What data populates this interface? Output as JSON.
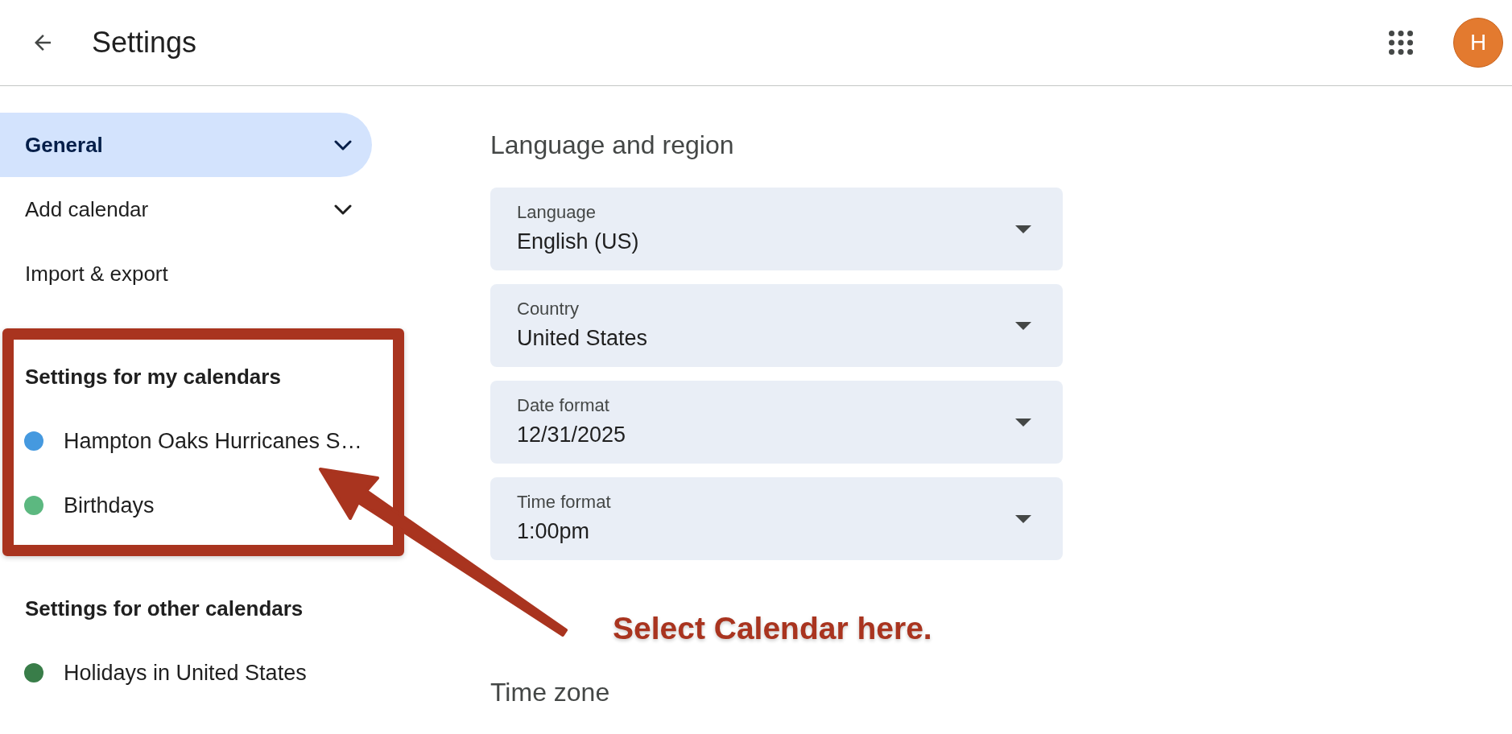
{
  "header": {
    "title": "Settings",
    "avatar_initial": "H"
  },
  "sidebar": {
    "nav_items": [
      {
        "label": "General",
        "kind": "expandable",
        "selected": true
      },
      {
        "label": "Add calendar",
        "kind": "expandable",
        "selected": false
      },
      {
        "label": "Import & export",
        "kind": "link",
        "selected": false
      }
    ],
    "sections": [
      {
        "title": "Settings for my calendars",
        "calendars": [
          {
            "name": "Hampton Oaks Hurricanes S…",
            "color": "#4599df"
          },
          {
            "name": "Birthdays",
            "color": "#5cb880"
          }
        ]
      },
      {
        "title": "Settings for other calendars",
        "calendars": [
          {
            "name": "Holidays in United States",
            "color": "#397d49"
          }
        ]
      }
    ]
  },
  "main": {
    "sections": [
      {
        "title": "Language and region",
        "fields": [
          {
            "label": "Language",
            "value": "English (US)"
          },
          {
            "label": "Country",
            "value": "United States"
          },
          {
            "label": "Date format",
            "value": "12/31/2025"
          },
          {
            "label": "Time format",
            "value": "1:00pm"
          }
        ]
      },
      {
        "title": "Time zone"
      }
    ]
  },
  "annotation": {
    "text": "Select Calendar here."
  }
}
